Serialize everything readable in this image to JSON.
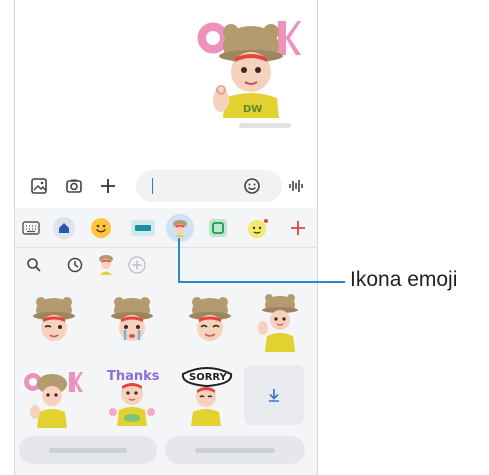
{
  "chat": {
    "received_sticker_icon": "bear-hat-ok-avatar-sticker",
    "message_time": ""
  },
  "input_bar": {
    "gallery_icon": "image-icon",
    "camera_icon": "camera-icon",
    "add_icon": "plus-icon",
    "text_value": "",
    "emoji_icon": "smiley-icon",
    "voice_icon": "waveform-icon"
  },
  "tabs": [
    {
      "icon": "keyboard-icon"
    },
    {
      "icon": "home-icon"
    },
    {
      "icon": "emoji-icon"
    },
    {
      "icon": "gif-icon"
    },
    {
      "icon": "ar-emoji-icon",
      "selected": true
    },
    {
      "icon": "sticker-icon"
    },
    {
      "icon": "bitmoji-icon"
    },
    {
      "icon": "plus-icon"
    }
  ],
  "subbar": {
    "search_icon": "search-icon",
    "recent_icon": "clock-icon",
    "avatar_icon": "avatar-icon",
    "add_icon": "plus-circle-icon"
  },
  "stickers": [
    {
      "icon": "avatar-wink-sticker"
    },
    {
      "icon": "avatar-cry-sticker"
    },
    {
      "icon": "avatar-smile-sticker"
    },
    {
      "icon": "avatar-wave-sticker"
    },
    {
      "icon": "avatar-ok-sticker"
    },
    {
      "icon": "avatar-thanks-sticker",
      "text": "Thanks"
    },
    {
      "icon": "avatar-sorry-sticker",
      "text": "SORRY"
    },
    {
      "icon": "download-icon"
    }
  ],
  "bottom_buttons": [
    {
      "label": ""
    },
    {
      "label": ""
    }
  ],
  "callout": {
    "label": "Ikona emoji",
    "color": "#2f86c8"
  },
  "colors": {
    "accent": "#2f86c8",
    "selected_tab_bg": "#cfe0f7",
    "bear_hat": "#b39a6f",
    "shirt": "#e2d130",
    "ok_letters": "#ee92bd",
    "red": "#e8423b"
  }
}
